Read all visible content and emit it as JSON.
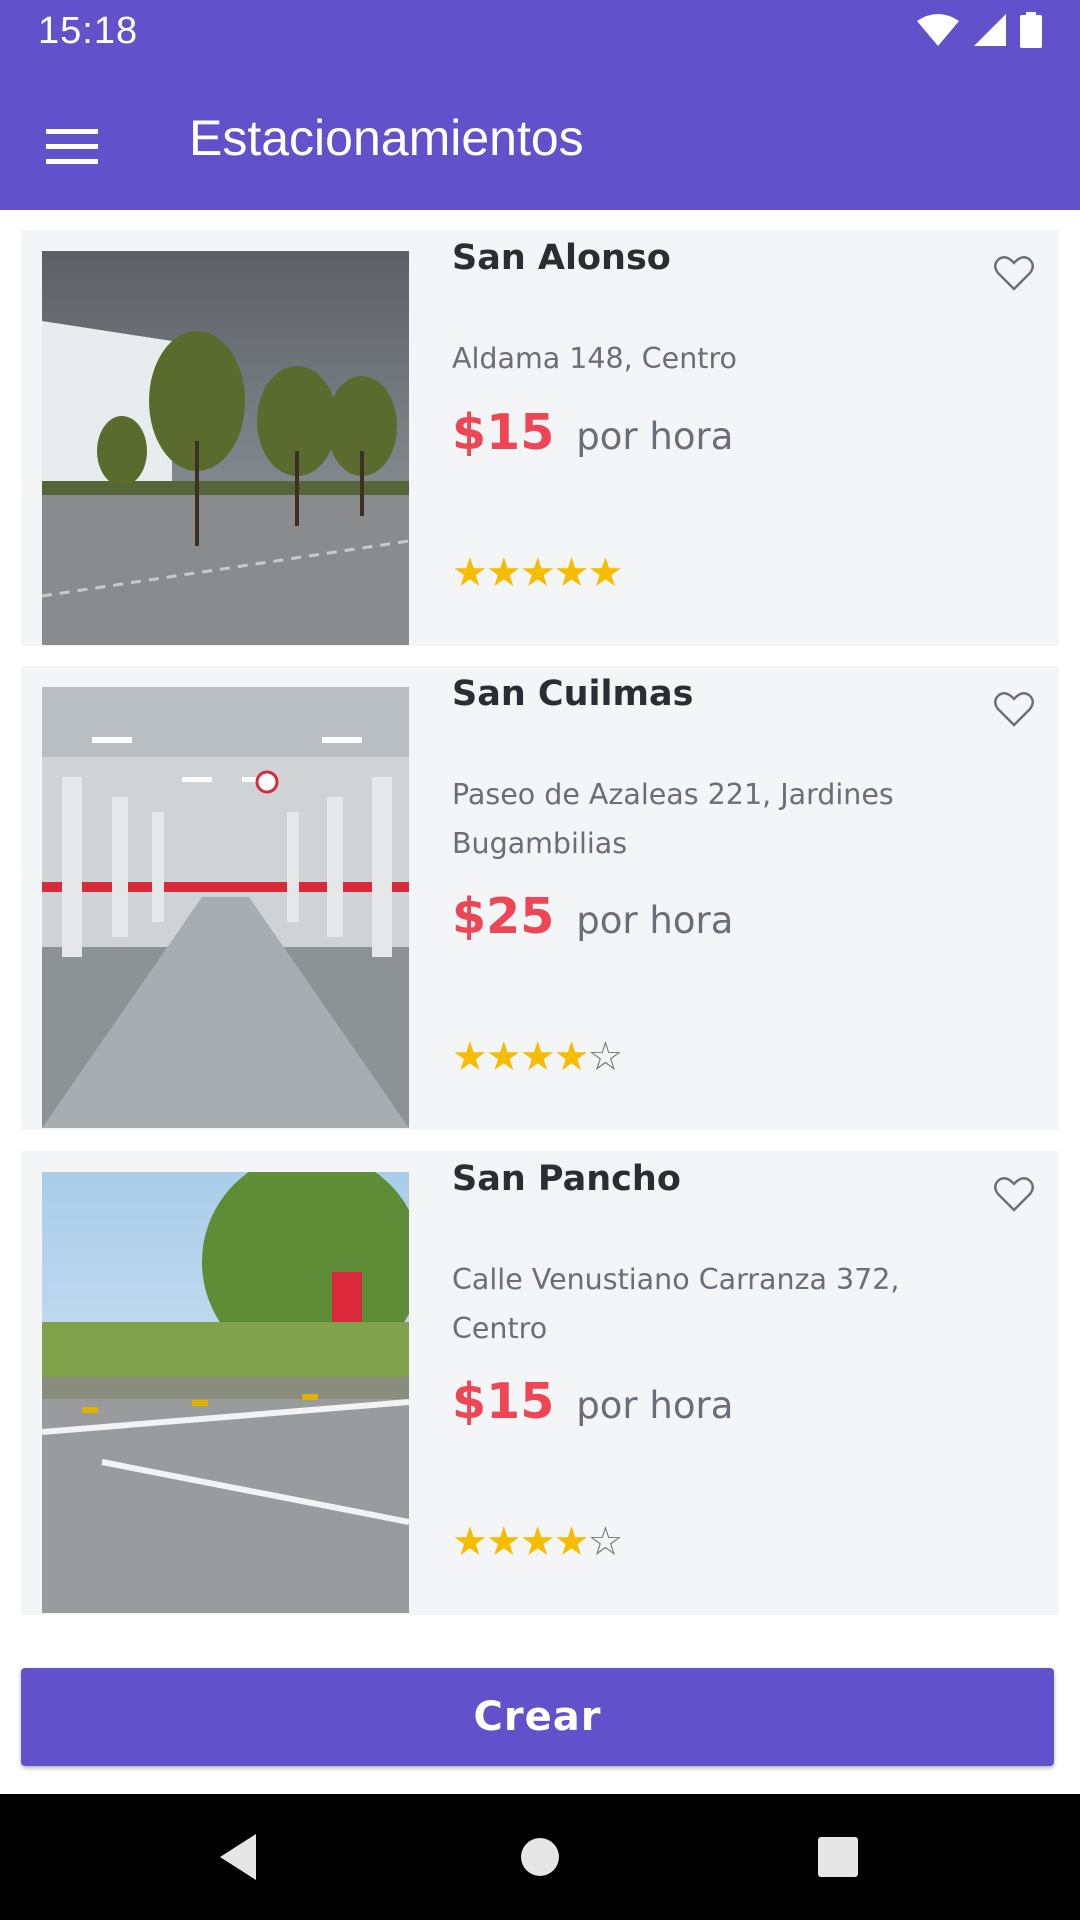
{
  "status_bar": {
    "time": "15:18",
    "icons": [
      "wifi-icon",
      "signal-icon",
      "battery-icon"
    ]
  },
  "app_bar": {
    "title": "Estacionamientos",
    "menu_icon": "hamburger-menu-icon"
  },
  "listings": [
    {
      "name": "San Alonso",
      "address": "Aldama 148, Centro",
      "price": "$15",
      "unit": "por hora",
      "rating": 5,
      "image": "outdoor lot with trees, cloudy sky"
    },
    {
      "name": "San Cuilmas",
      "address": "Paseo de Azaleas 221, Jardines Bugambilias",
      "price": "$25",
      "unit": "por hora",
      "rating": 4,
      "image": "underground parking garage"
    },
    {
      "name": "San Pancho",
      "address": "Calle Venustiano Carranza 372, Centro",
      "price": "$15",
      "unit": "por hora",
      "rating": 4,
      "image": "outdoor lot with hedges"
    }
  ],
  "actions": {
    "create_label": "Crear"
  },
  "colors": {
    "primary": "#6152cc",
    "price": "#ee4655",
    "star": "#f5bc00",
    "card_bg": "#f4f5f7"
  },
  "nav": {
    "icons": [
      "back-icon",
      "home-icon",
      "recents-icon"
    ]
  }
}
